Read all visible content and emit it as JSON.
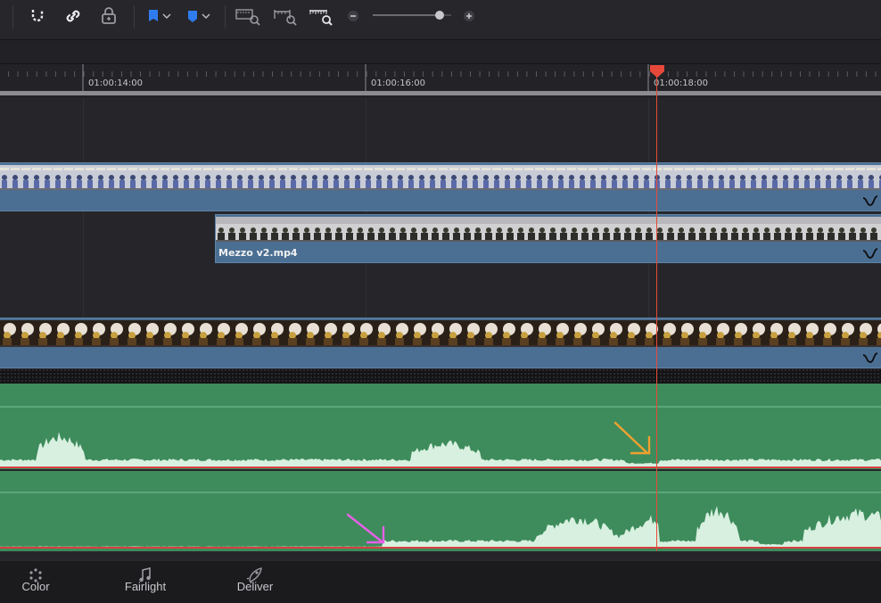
{
  "toolbar": {
    "icons": [
      "snapping-icon",
      "link-icon",
      "lock-position-icon",
      "flag-icon",
      "marker-icon",
      "zoom-full-icon",
      "zoom-detail-icon",
      "zoom-custom-icon",
      "zoom-out-icon",
      "zoom-in-icon"
    ],
    "zoom_slider_value": 0.85,
    "colors": {
      "flag": "#2f7bf0",
      "marker": "#2f7bf0"
    }
  },
  "ruler": {
    "timecodes": [
      "01:00:14:00",
      "01:00:16:00",
      "01:00:18:00"
    ],
    "playhead_color": "#e8483a"
  },
  "tracks": {
    "clip_top": {
      "name": ""
    },
    "clip_middle": {
      "name": "Mezzo v2.mp4"
    },
    "clip_bottom": {
      "name": ""
    },
    "video_clip_color": "#4b6f92",
    "audio_clip_color": "#3e8c5c",
    "waveform_color": "#d8f0e0"
  },
  "annotations": {
    "orange_arrow_color": "#f0a030",
    "pink_arrow_color": "#e860e8"
  },
  "pages": [
    {
      "label": "Color",
      "icon": "color-page-icon"
    },
    {
      "label": "Fairlight",
      "icon": "fairlight-page-icon"
    },
    {
      "label": "Deliver",
      "icon": "deliver-page-icon"
    }
  ]
}
